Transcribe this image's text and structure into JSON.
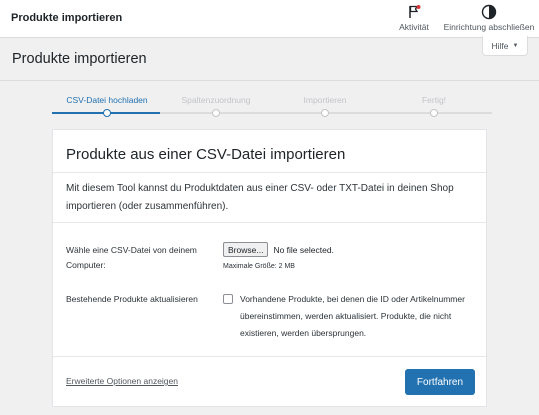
{
  "topbar": {
    "title": "Produkte importieren",
    "actions": [
      {
        "label": "Aktivität",
        "icon": "flag-icon"
      },
      {
        "label": "Einrichtung abschließen",
        "icon": "progress-circle-icon"
      }
    ]
  },
  "header": {
    "title": "Produkte importieren",
    "help_label": "Hilfe"
  },
  "stepper": {
    "steps": [
      {
        "label": "CSV-Datei hochladen",
        "active": true
      },
      {
        "label": "Spaltenzuordnung",
        "active": false
      },
      {
        "label": "Importieren",
        "active": false
      },
      {
        "label": "Fertig!",
        "active": false
      }
    ]
  },
  "card": {
    "title": "Produkte aus einer CSV-Datei importieren",
    "description": "Mit diesem Tool kannst du Produktdaten aus einer CSV- oder TXT-Datei in deinen Shop importieren (oder zusammenführen).",
    "file_label": "Wähle eine CSV-Datei von deinem Computer:",
    "browse_label": "Browse...",
    "file_status": "No file selected.",
    "max_size": "Maximale Größe: 2 MB",
    "update_label": "Bestehende Produkte aktualisieren",
    "update_checked": false,
    "update_text": "Vorhandene Produkte, bei denen die ID oder Artikelnummer übereinstimmen, werden aktualisiert. Produkte, die nicht existieren, werden übersprungen.",
    "advanced_link": "Erweiterte Optionen anzeigen",
    "continue_label": "Fortfahren"
  },
  "colors": {
    "accent": "#2271b1",
    "inactive": "#c3c4c7",
    "background": "#f0f0f1"
  }
}
